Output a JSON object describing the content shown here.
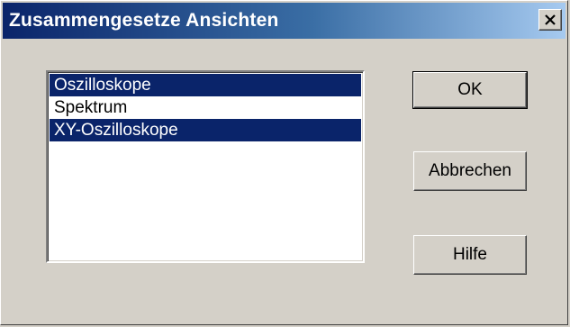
{
  "window": {
    "title": "Zusammengesetze Ansichten"
  },
  "titlebar": {
    "close_icon": "close-icon",
    "colors": {
      "active_start": "#0a246a",
      "active_end": "#a6caf0"
    }
  },
  "list": {
    "items": [
      {
        "label": "Oszilloskope",
        "selected": true
      },
      {
        "label": "Spektrum",
        "selected": false
      },
      {
        "label": "XY-Oszilloskope",
        "selected": true
      }
    ],
    "selection_color": "#0a246a"
  },
  "buttons": {
    "ok_label": "OK",
    "cancel_label": "Abbrechen",
    "help_label": "Hilfe"
  }
}
